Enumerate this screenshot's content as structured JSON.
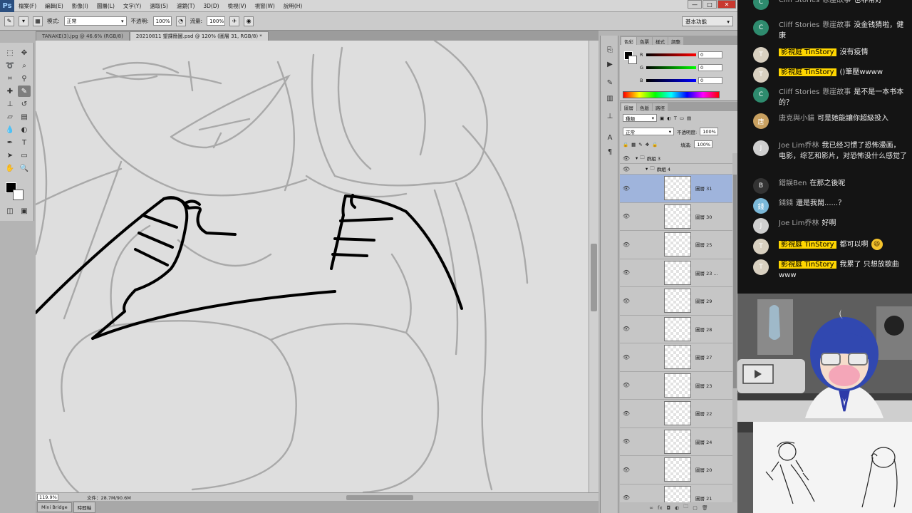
{
  "photoshop": {
    "logo": "Ps",
    "menus": [
      "檔案(F)",
      "編輯(E)",
      "影像(I)",
      "圖層(L)",
      "文字(Y)",
      "選取(S)",
      "濾鏡(T)",
      "3D(D)",
      "檢視(V)",
      "視窗(W)",
      "說明(H)"
    ],
    "window_controls": [
      "—",
      "□",
      "✕"
    ],
    "options": {
      "mode_label": "模式:",
      "mode_value": "正常",
      "opacity_label": "不透明:",
      "opacity_value": "100%",
      "flow_label": "流量:",
      "flow_value": "100%"
    },
    "workspace": "基本功能",
    "tabs": [
      "TANAKE(3).jpg @ 46.6% (RGB/8)",
      "20210811 望課簡圖.psd @ 120% (圖層 31, RGB/8) *"
    ],
    "status": {
      "zoom": "119.9%",
      "doc_info": "文件：28.7M/90.6M"
    },
    "bottom_tabs": [
      "Mini Bridge",
      "時間軸"
    ],
    "color_panel": {
      "tabs": [
        "色彩",
        "色票",
        "樣式",
        "調整"
      ],
      "r_label": "R",
      "r_value": "0",
      "g_label": "G",
      "g_value": "0",
      "b_label": "B",
      "b_value": "0"
    },
    "layers_panel": {
      "tabs": [
        "圖層",
        "色版",
        "路徑"
      ],
      "kind_filter": "種類",
      "blend_mode": "正常",
      "opacity_label": "不透明度:",
      "opacity_value": "100%",
      "fill_label": "填滿:",
      "fill_value": "100%",
      "groups": [
        "群組 3",
        "群組 4"
      ],
      "layers": [
        "圖層 31",
        "圖層 30",
        "圖層 25",
        "圖層 23 ...",
        "圖層 29",
        "圖層 28",
        "圖層 27",
        "圖層 23",
        "圖層 22",
        "圖層 24",
        "圖層 20",
        "圖層 21"
      ],
      "selected_index": 0
    }
  },
  "chat": {
    "messages": [
      {
        "author": "Cliff Stories",
        "badge": "懸崖故事",
        "text": "也非常好",
        "avatar": "C",
        "avatar_color": "#2e8b6e",
        "member": false
      },
      {
        "author": "Cliff Stories",
        "badge": "懸崖故事",
        "text": "没金钱猜啦，健康",
        "avatar": "C",
        "avatar_color": "#2e8b6e",
        "member": false
      },
      {
        "author": "影視庭 TinStory",
        "badge": "",
        "text": "沒有疫情",
        "avatar": "T",
        "avatar_color": "#d8d0c0",
        "member": true
      },
      {
        "author": "影視庭 TinStory",
        "badge": "",
        "text": "()筆壓wwww",
        "avatar": "T",
        "avatar_color": "#d8d0c0",
        "member": true
      },
      {
        "author": "Cliff Stories",
        "badge": "懸崖故事",
        "text": "是不是一本书本的？",
        "avatar": "C",
        "avatar_color": "#2e8b6e",
        "member": false
      },
      {
        "author": "唐克與小貓",
        "badge": "",
        "text": "可是她能讓你超級投入",
        "avatar": "唐",
        "avatar_color": "#c8a060",
        "member": false
      },
      {
        "author": "Joe Lim乔林",
        "badge": "",
        "text": "我已经习惯了恐怖漫画，电影，综艺和影片，对恐怖没什么感觉了",
        "avatar": "J",
        "avatar_color": "#cfcfcf",
        "member": false
      },
      {
        "author": "錯誤Ben",
        "badge": "",
        "text": "在那之後呢",
        "avatar": "B",
        "avatar_color": "#333333",
        "member": false
      },
      {
        "author": "錢錢",
        "badge": "",
        "text": "還是我鬧......？",
        "avatar": "錢",
        "avatar_color": "#7ab8d8",
        "member": false
      },
      {
        "author": "Joe Lim乔林",
        "badge": "",
        "text": "好啊",
        "avatar": "J",
        "avatar_color": "#cfcfcf",
        "member": false
      },
      {
        "author": "影視庭 TinStory",
        "badge": "",
        "text": "都可以啊",
        "emoji": "😆",
        "avatar": "T",
        "avatar_color": "#d8d0c0",
        "member": true
      },
      {
        "author": "影視庭 TinStory",
        "badge": "",
        "text": "我累了 只想放歌曲www",
        "avatar": "T",
        "avatar_color": "#d8d0c0",
        "member": true
      }
    ]
  },
  "colors": {
    "chat_bg": "#141414",
    "member_badge": "#ffd600",
    "ps_panel": "#c6c6c6",
    "selected_layer": "#9fb4dc"
  }
}
